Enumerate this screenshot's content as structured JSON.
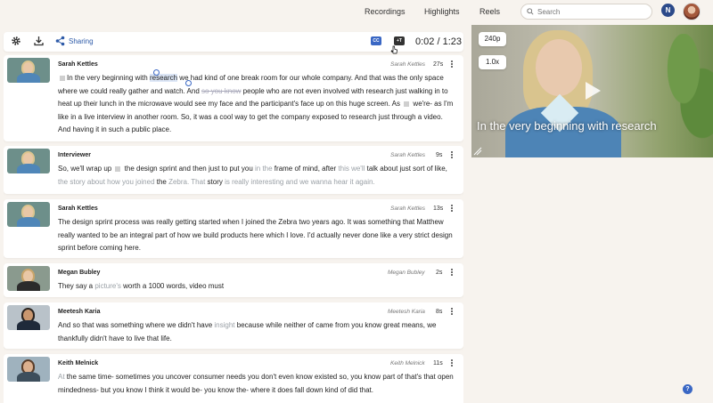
{
  "nav": {
    "recordings": "Recordings",
    "highlights": "Highlights",
    "reels": "Reels",
    "search_placeholder": "Search",
    "user_initial": "N"
  },
  "toolbar": {
    "sharing_label": "Sharing",
    "cc_label": "CC",
    "x_label": "+T",
    "time": "0:02 / 1:23"
  },
  "video": {
    "caption": "In the very beginning with research",
    "resolution": "240p",
    "speed": "1.0x"
  },
  "blocks": [
    {
      "speaker": "Sarah Kettles",
      "attribution": "Sarah Kettles",
      "duration": "27s",
      "p1": "In the very beginning with ",
      "sel": "research",
      "p2": " we had kind of one break room for our whole company. And that was the only space where we could really gather and watch. And ",
      "strike": "so you know",
      "p3": " people who are not even involved with research just walking in to heat up their lunch in the microwave would see my face and the participant's face up on this huge screen. As ",
      "p4": " we're- as I'm like in a live interview in another room. So, it was a cool way to get the company exposed to research just through a video. And having it in such a public place."
    },
    {
      "speaker": "Interviewer",
      "attribution": "Sarah Kettles",
      "duration": "9s",
      "p1": "So, we'll wrap up ",
      "p2": " the design sprint and then just to put you ",
      "f1": "in the",
      "p3": " frame of mind, after ",
      "f2": "this we'll",
      "p4": " talk about just sort of like, ",
      "f3": "the story about how you joined",
      "p5": " the ",
      "f4": "Zebra. That",
      "p6": " story ",
      "f5": "is really interesting and we wanna hear it again."
    },
    {
      "speaker": "Sarah Kettles",
      "attribution": "Sarah Kettles",
      "duration": "13s",
      "text": "The design sprint process was really getting started when I joined the Zebra two years ago. It was something that Matthew really wanted to be an integral part of how we build products here which I love. I'd actually never done like a very strict design sprint before coming here."
    },
    {
      "speaker": "Megan Bubley",
      "attribution": "Megan Bubley",
      "duration": "2s",
      "p1": "They say a ",
      "f1": "picture's",
      "p2": " worth a 1000 words, video must"
    },
    {
      "speaker": "Meetesh Karia",
      "attribution": "Meetesh Karia",
      "duration": "8s",
      "p1": "And so that was something where we didn't have ",
      "f1": "insight",
      "p2": " because while neither of came from you know great means, we thankfully didn't have to live that life."
    },
    {
      "speaker": "Keith Melnick",
      "attribution": "Keith Melnick",
      "duration": "11s",
      "f1": "At",
      "p1": " the same time- sometimes you uncover consumer needs you don't even know existed so, you know part of that's that open mindedness- but you know I think it would be- you know the- where it does fall down kind of did that."
    }
  ],
  "help": "?"
}
